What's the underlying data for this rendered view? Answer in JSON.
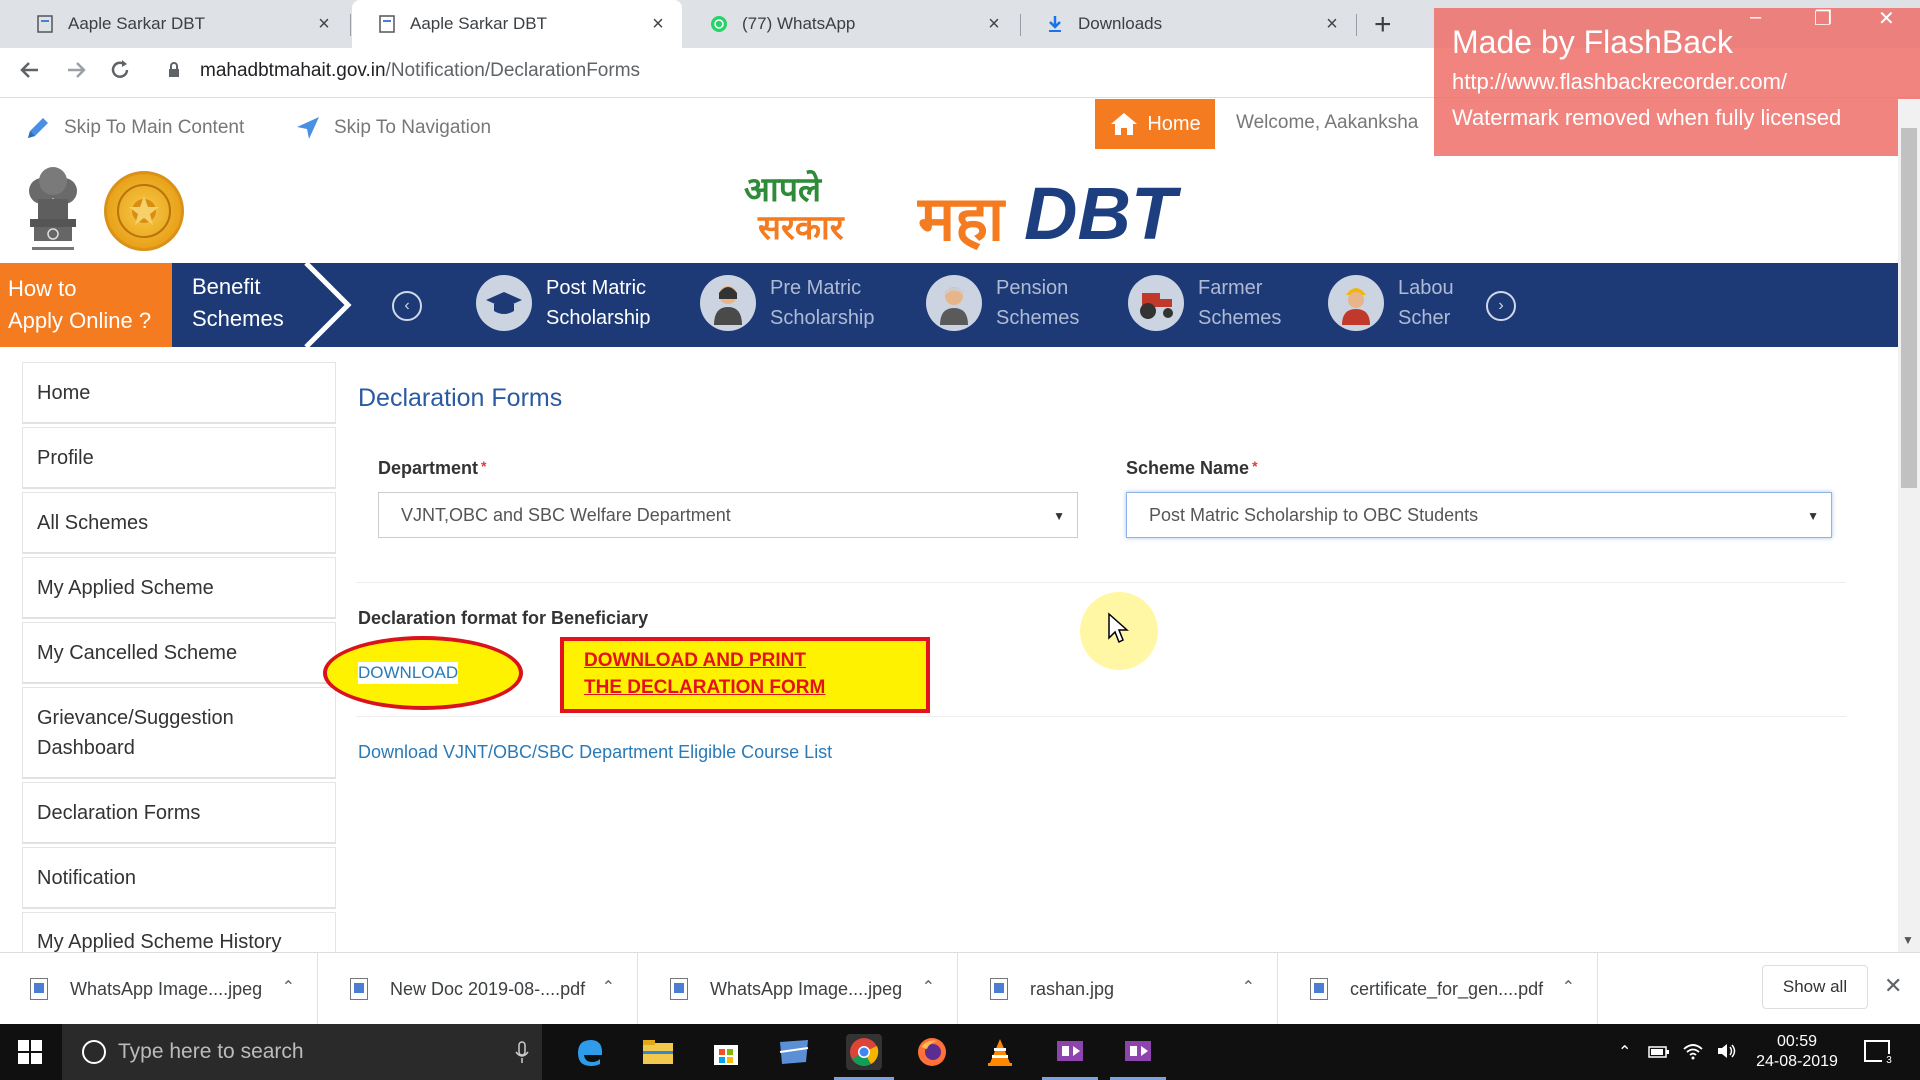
{
  "browser": {
    "tabs": [
      {
        "title": "Aaple Sarkar DBT",
        "active": false
      },
      {
        "title": "Aaple Sarkar DBT",
        "active": true
      },
      {
        "title": "(77) WhatsApp",
        "active": false
      },
      {
        "title": "Downloads",
        "active": false
      }
    ],
    "url_domain": "mahadbtmahait.gov.in",
    "url_path": "/Notification/DeclarationForms"
  },
  "watermark": {
    "line1": "Made by FlashBack",
    "line2": "http://www.flashbackrecorder.com/",
    "line3": "Watermark removed when fully licensed"
  },
  "skipbar": {
    "skip_main": "Skip To Main Content",
    "skip_nav": "Skip To Navigation",
    "home": "Home",
    "welcome": "Welcome, Aakanksha"
  },
  "header": {
    "aaple_line1": "आपले",
    "aaple_line2": "सरकार",
    "maha": "महा",
    "dbt": "DBT"
  },
  "nav": {
    "howto_line1": "How to",
    "howto_line2": "Apply Online ?",
    "benefit_line1": "Benefit",
    "benefit_line2": "Schemes",
    "schemes": [
      {
        "line1": "Post Matric",
        "line2": "Scholarship",
        "active": true
      },
      {
        "line1": "Pre Matric",
        "line2": "Scholarship",
        "active": false
      },
      {
        "line1": "Pension",
        "line2": "Schemes",
        "active": false
      },
      {
        "line1": "Farmer",
        "line2": "Schemes",
        "active": false
      },
      {
        "line1": "Labou",
        "line2": "Scher",
        "active": false
      }
    ]
  },
  "sidebar": {
    "items": [
      {
        "label": "Home"
      },
      {
        "label": "Profile"
      },
      {
        "label": "All Schemes"
      },
      {
        "label": "My Applied Scheme"
      },
      {
        "label": "My Cancelled Scheme"
      },
      {
        "label": "Grievance/Suggestion",
        "label2": "Dashboard"
      },
      {
        "label": "Declaration Forms"
      },
      {
        "label": "Notification"
      },
      {
        "label": "My Applied Scheme History"
      }
    ]
  },
  "main": {
    "title": "Declaration Forms",
    "department_label": "Department",
    "department_value": "VJNT,OBC and SBC Welfare Department",
    "scheme_label": "Scheme Name",
    "scheme_value": "Post Matric Scholarship to OBC Students",
    "declaration_label": "Declaration format for Beneficiary",
    "download_link": "DOWNLOAD",
    "annotation_line1": "DOWNLOAD AND PRINT",
    "annotation_line2": "THE DECLARATION FORM",
    "course_list_link": "Download VJNT/OBC/SBC Department Eligible Course List",
    "required_mark": "*"
  },
  "downloads": {
    "items": [
      {
        "name": "WhatsApp Image....jpeg"
      },
      {
        "name": "New Doc 2019-08-....pdf"
      },
      {
        "name": "WhatsApp Image....jpeg"
      },
      {
        "name": "rashan.jpg"
      },
      {
        "name": "certificate_for_gen....pdf"
      }
    ],
    "show_all": "Show all"
  },
  "taskbar": {
    "search_placeholder": "Type here to search",
    "time": "00:59",
    "date": "24-08-2019",
    "notification_count": "3"
  },
  "colors": {
    "orange": "#f47b20",
    "navy": "#1d3a76",
    "link_blue": "#2a7ab8",
    "annotation_red": "#e3121c",
    "annotation_yellow": "#fff200"
  }
}
